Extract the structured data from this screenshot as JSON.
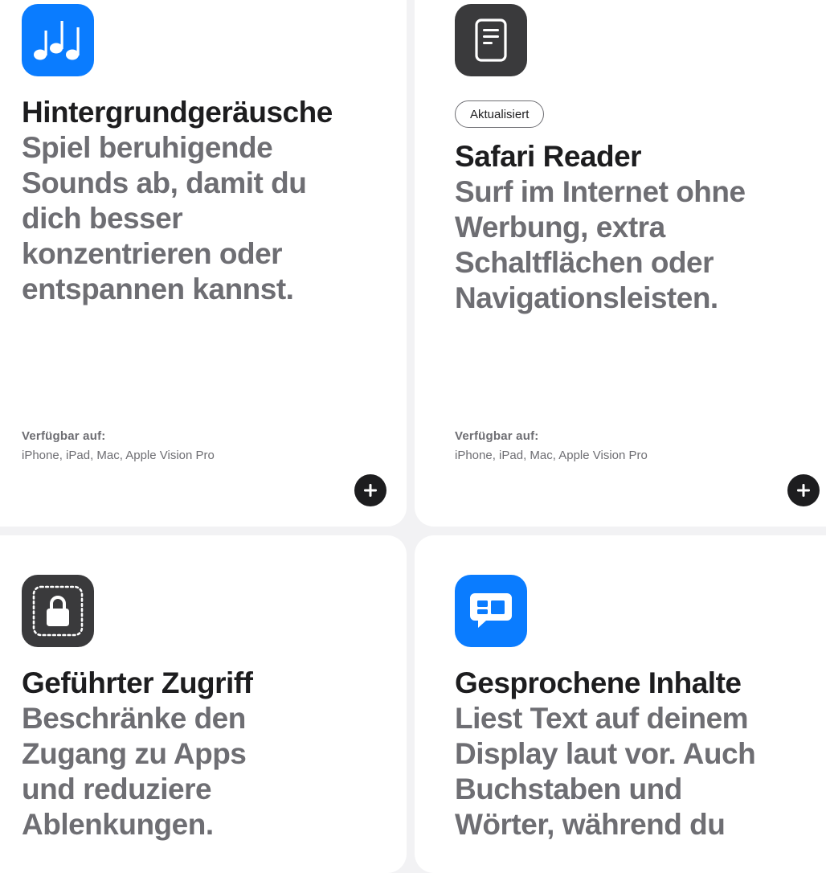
{
  "cards": [
    {
      "icon": "music-notes-icon",
      "icon_color": "#0a7cff",
      "title": "Hintergrundgeräusche",
      "description": "Spiel beruhigende Sounds ab, damit du dich besser konzentrieren oder entspannen kannst.",
      "available_label": "Verfügbar auf:",
      "devices": "iPhone, iPad, Mac, Apple Vision Pro"
    },
    {
      "icon": "reader-document-icon",
      "icon_color": "#3a3a3c",
      "badge": "Aktualisiert",
      "title": "Safari Reader",
      "description": "Surf im Internet ohne Werbung, extra Schaltflächen oder Navigationsleisten.",
      "available_label": "Verfügbar auf:",
      "devices": "iPhone, iPad, Mac, Apple Vision Pro"
    },
    {
      "icon": "lock-icon",
      "icon_color": "#3a3a3c",
      "title": "Geführter Zugriff",
      "description": "Beschränke den Zugang zu Apps und reduziere Ablenkungen."
    },
    {
      "icon": "speech-bubble-icon",
      "icon_color": "#0a7cff",
      "title": "Gesprochene Inhalte",
      "description": "Liest Text auf deinem Display laut vor. Auch Buchstaben und Wörter, während du"
    }
  ]
}
